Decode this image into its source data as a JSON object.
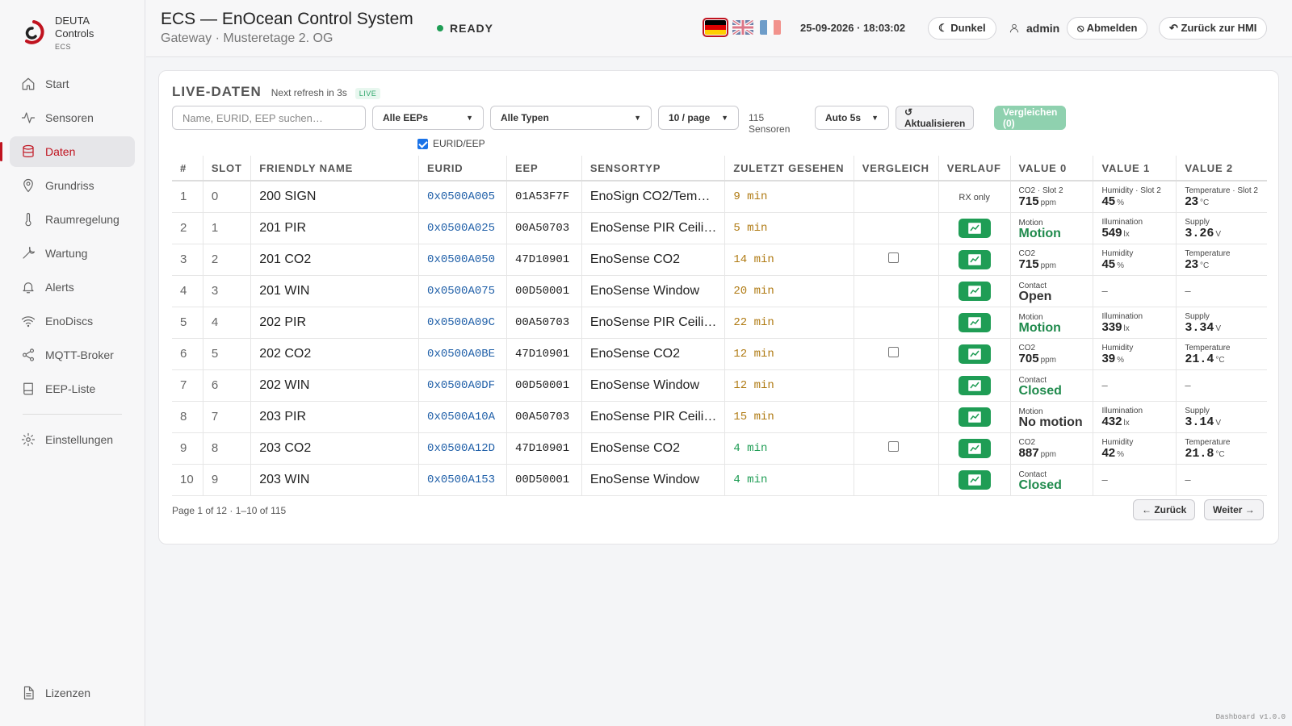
{
  "brand": {
    "line1": "DEUTA",
    "line2": "Controls",
    "line3": "ECS"
  },
  "sidebar": {
    "items": [
      {
        "label": "Start",
        "icon": "home-icon"
      },
      {
        "label": "Sensoren",
        "icon": "activity-icon"
      },
      {
        "label": "Daten",
        "icon": "database-icon",
        "active": true
      },
      {
        "label": "Grundriss",
        "icon": "map-pin-icon"
      },
      {
        "label": "Raumregelung",
        "icon": "thermometer-icon"
      },
      {
        "label": "Wartung",
        "icon": "wrench-icon"
      },
      {
        "label": "Alerts",
        "icon": "bell-icon"
      },
      {
        "label": "EnoDiscs",
        "icon": "wifi-icon"
      },
      {
        "label": "MQTT-Broker",
        "icon": "share-icon"
      },
      {
        "label": "EEP-Liste",
        "icon": "book-icon"
      }
    ],
    "settings_label": "Einstellungen",
    "licenses_label": "Lizenzen"
  },
  "header": {
    "title": "ECS — EnOcean Control System",
    "subtitle": "Gateway · Musteretage 2. OG",
    "status": "READY",
    "datetime": "25-09-2026 · 18:03:02",
    "dark_label": "☾ Dunkel",
    "user": "admin",
    "logout_label": "⦸ Abmelden",
    "back_hmi_label": "↶ Zurück zur HMI",
    "active_lang": "de"
  },
  "live": {
    "title": "LIVE-DATEN",
    "refresh": "Next refresh in 3s",
    "badge": "LIVE",
    "search_placeholder": "Name, EURID, EEP suchen…",
    "eep_filter": "Alle EEPs",
    "type_filter": "Alle Typen",
    "page_size": "10 / page",
    "sensor_count": "115 Sensoren",
    "auto": "Auto 5s",
    "refresh_btn": "↺ Aktualisieren",
    "compare_btn": "Vergleichen (0)",
    "eurid_toggle": "EURID/EEP",
    "pager_info": "Page 1 of 12 · 1–10 of 115",
    "prev": "← Zurück",
    "next": "Weiter →"
  },
  "columns": [
    "#",
    "SLOT",
    "FRIENDLY NAME",
    "EURID",
    "EEP",
    "SENSORTYP",
    "ZULETZT GESEHEN",
    "VERGLEICH",
    "VERLAUF",
    "VALUE 0",
    "VALUE 1",
    "VALUE 2"
  ],
  "rows": [
    {
      "n": "1",
      "slot": "0",
      "name": "200 SIGN",
      "eurid": "0x0500A005",
      "eep": "01A53F7F",
      "type": "EnoSign CO2/Tem…",
      "seen": "9 min",
      "compare": false,
      "history": "RX only",
      "v0": {
        "label": "CO2 · Slot 2",
        "value": "715",
        "unit": "ppm"
      },
      "v1": {
        "label": "Humidity · Slot 2",
        "value": "45",
        "unit": "%"
      },
      "v2": {
        "label": "Temperature · Slot 2",
        "value": "23",
        "unit": "°C"
      }
    },
    {
      "n": "2",
      "slot": "1",
      "name": "201 PIR",
      "eurid": "0x0500A025",
      "eep": "00A50703",
      "type": "EnoSense PIR Ceili…",
      "seen": "5 min",
      "compare": false,
      "history": "chart",
      "v0": {
        "label": "Motion",
        "value": "Motion",
        "unit": "",
        "state": "green"
      },
      "v1": {
        "label": "Illumination",
        "value": "549",
        "unit": "lx"
      },
      "v2": {
        "label": "Supply",
        "value": "3.26",
        "unit": "V"
      }
    },
    {
      "n": "3",
      "slot": "2",
      "name": "201 CO2",
      "eurid": "0x0500A050",
      "eep": "47D10901",
      "type": "EnoSense CO2",
      "seen": "14 min",
      "compare": true,
      "history": "chart",
      "v0": {
        "label": "CO2",
        "value": "715",
        "unit": "ppm"
      },
      "v1": {
        "label": "Humidity",
        "value": "45",
        "unit": "%"
      },
      "v2": {
        "label": "Temperature",
        "value": "23",
        "unit": "°C"
      }
    },
    {
      "n": "4",
      "slot": "3",
      "name": "201 WIN",
      "eurid": "0x0500A075",
      "eep": "00D50001",
      "type": "EnoSense Window",
      "seen": "20 min",
      "compare": false,
      "history": "chart",
      "v0": {
        "label": "Contact",
        "value": "Open",
        "unit": "",
        "state": "dark"
      },
      "v1": {
        "dash": "–"
      },
      "v2": {
        "dash": "–"
      }
    },
    {
      "n": "5",
      "slot": "4",
      "name": "202 PIR",
      "eurid": "0x0500A09C",
      "eep": "00A50703",
      "type": "EnoSense PIR Ceili…",
      "seen": "22 min",
      "compare": false,
      "history": "chart",
      "v0": {
        "label": "Motion",
        "value": "Motion",
        "unit": "",
        "state": "green"
      },
      "v1": {
        "label": "Illumination",
        "value": "339",
        "unit": "lx"
      },
      "v2": {
        "label": "Supply",
        "value": "3.34",
        "unit": "V"
      }
    },
    {
      "n": "6",
      "slot": "5",
      "name": "202 CO2",
      "eurid": "0x0500A0BE",
      "eep": "47D10901",
      "type": "EnoSense CO2",
      "seen": "12 min",
      "compare": true,
      "history": "chart",
      "v0": {
        "label": "CO2",
        "value": "705",
        "unit": "ppm"
      },
      "v1": {
        "label": "Humidity",
        "value": "39",
        "unit": "%"
      },
      "v2": {
        "label": "Temperature",
        "value": "21.4",
        "unit": "°C"
      }
    },
    {
      "n": "7",
      "slot": "6",
      "name": "202 WIN",
      "eurid": "0x0500A0DF",
      "eep": "00D50001",
      "type": "EnoSense Window",
      "seen": "12 min",
      "compare": false,
      "history": "chart",
      "v0": {
        "label": "Contact",
        "value": "Closed",
        "unit": "",
        "state": "green"
      },
      "v1": {
        "dash": "–"
      },
      "v2": {
        "dash": "–"
      }
    },
    {
      "n": "8",
      "slot": "7",
      "name": "203 PIR",
      "eurid": "0x0500A10A",
      "eep": "00A50703",
      "type": "EnoSense PIR Ceili…",
      "seen": "15 min",
      "compare": false,
      "history": "chart",
      "v0": {
        "label": "Motion",
        "value": "No motion",
        "unit": "",
        "state": "dark"
      },
      "v1": {
        "label": "Illumination",
        "value": "432",
        "unit": "lx"
      },
      "v2": {
        "label": "Supply",
        "value": "3.14",
        "unit": "V"
      }
    },
    {
      "n": "9",
      "slot": "8",
      "name": "203 CO2",
      "eurid": "0x0500A12D",
      "eep": "47D10901",
      "type": "EnoSense CO2",
      "seen": "4 min",
      "seen_ok": true,
      "compare": true,
      "history": "chart",
      "v0": {
        "label": "CO2",
        "value": "887",
        "unit": "ppm"
      },
      "v1": {
        "label": "Humidity",
        "value": "42",
        "unit": "%"
      },
      "v2": {
        "label": "Temperature",
        "value": "21.8",
        "unit": "°C"
      }
    },
    {
      "n": "10",
      "slot": "9",
      "name": "203 WIN",
      "eurid": "0x0500A153",
      "eep": "00D50001",
      "type": "EnoSense Window",
      "seen": "4 min",
      "seen_ok": true,
      "compare": false,
      "history": "chart",
      "v0": {
        "label": "Contact",
        "value": "Closed",
        "unit": "",
        "state": "green"
      },
      "v1": {
        "dash": "–"
      },
      "v2": {
        "dash": "–"
      }
    }
  ],
  "footer": "Dashboard v1.0.0",
  "colors": {
    "accent": "#c0131f",
    "success": "#1f9d55",
    "warn": "#b07b14",
    "link": "#1f5fa8"
  }
}
